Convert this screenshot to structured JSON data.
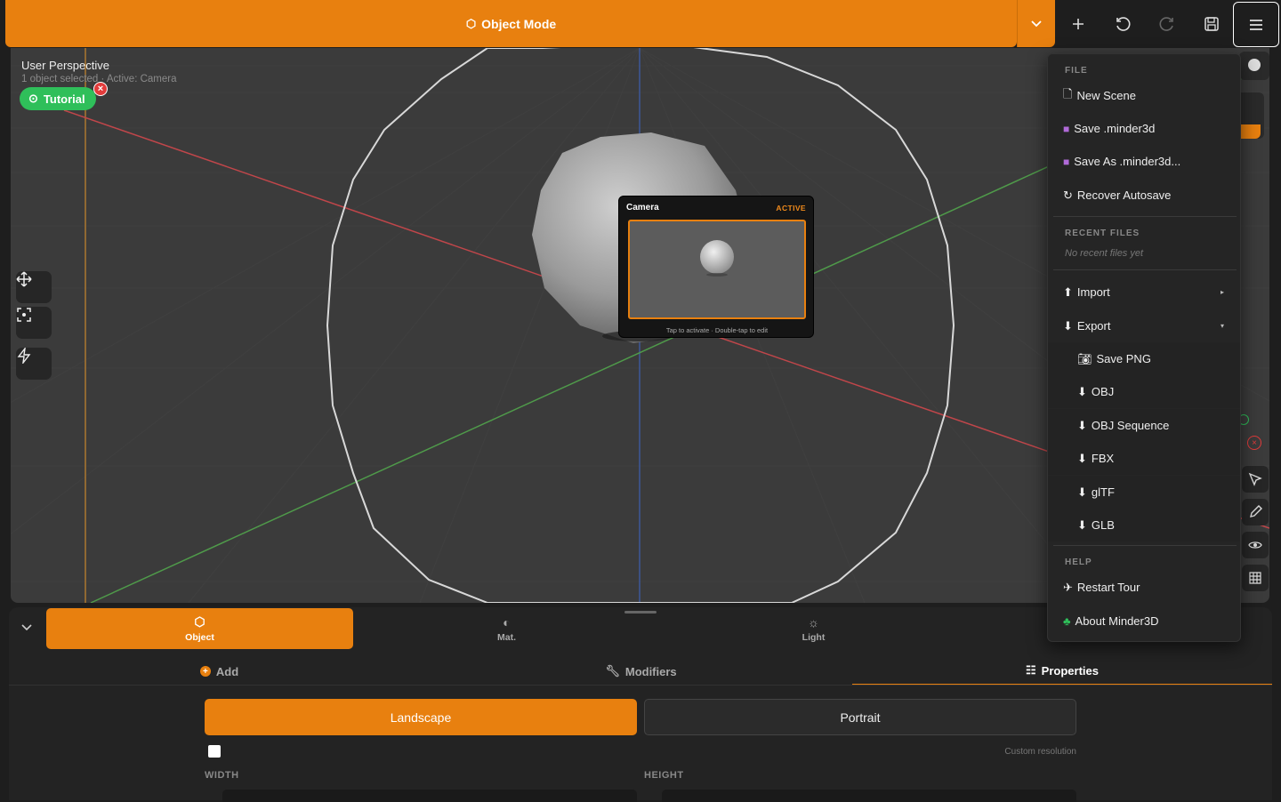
{
  "topbar": {
    "mode_label": "Object Mode",
    "icons": [
      "cube-icon",
      "chevron-down-icon",
      "plus-icon",
      "undo-icon",
      "redo-icon",
      "save-icon",
      "menu-icon"
    ]
  },
  "viewport": {
    "title": "User Perspective",
    "subtitle": "1 object selected · Active: Camera",
    "tutorial_label": "Tutorial",
    "tools": [
      "move-icon",
      "frame-icon",
      "bolt-icon"
    ]
  },
  "camera_card": {
    "title": "Camera",
    "status": "ACTIVE",
    "hint": "Tap to activate · Double-tap to edit"
  },
  "panel": {
    "tabs": [
      {
        "label": "Object",
        "icon": "cube-icon"
      },
      {
        "label": "Mat.",
        "icon": "material-icon"
      },
      {
        "label": "Light",
        "icon": "sun-icon"
      }
    ],
    "subtabs": [
      {
        "label": "Add"
      },
      {
        "label": "Modifiers"
      },
      {
        "label": "Properties"
      }
    ],
    "landscape_label": "Landscape",
    "portrait_label": "Portrait",
    "custom_res_label": "Custom resolution",
    "width_label": "WIDTH",
    "height_label": "HEIGHT"
  },
  "menu": {
    "file_header": "FILE",
    "new_scene": "New Scene",
    "save": "Save .minder3d",
    "save_as": "Save As .minder3d...",
    "recover": "Recover Autosave",
    "recent_header": "RECENT FILES",
    "recent_empty": "No recent files yet",
    "import": "Import",
    "export": "Export",
    "export_items": [
      "Save PNG",
      "OBJ",
      "OBJ Sequence",
      "FBX",
      "glTF",
      "GLB"
    ],
    "help_header": "HELP",
    "restart_tour": "Restart Tour",
    "about": "About Minder3D"
  },
  "colors": {
    "accent": "#e8800f",
    "tutorial_green": "#2fbf5a",
    "x_axis": "#c0464a",
    "y_axis": "#4f9a4a",
    "z_axis": "#3e5fb0"
  }
}
